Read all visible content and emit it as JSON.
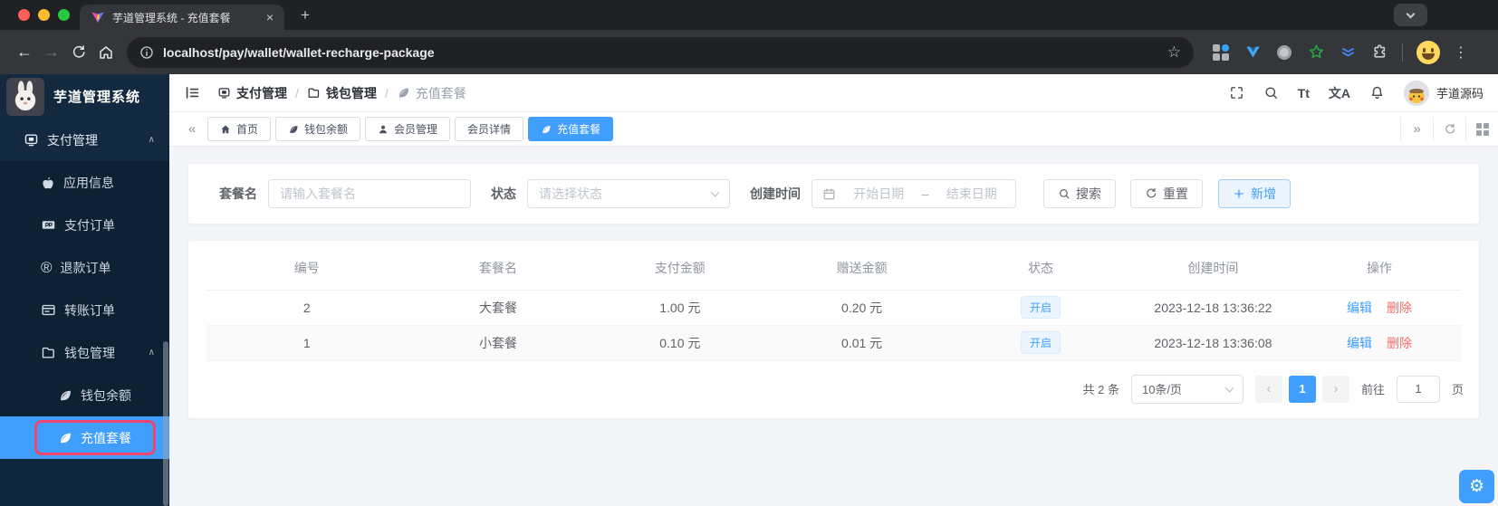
{
  "colors": {
    "accent": "#409eff",
    "danger": "#f56c6c",
    "status_tag_bg": "#ecf5ff",
    "inspect_highlight": "#f0436d",
    "sidebar_bg": "#10263c"
  },
  "browser": {
    "tab_title": "芋道管理系统 - 充值套餐",
    "url": "localhost/pay/wallet/wallet-recharge-package",
    "glyphs": {
      "close": "×",
      "new_tab": "+",
      "back": "←",
      "forward": "→",
      "star": "☆",
      "menu": "⋮"
    }
  },
  "sidebar": {
    "app_title": "芋道管理系统",
    "collapse_glyph": "∧",
    "items": {
      "pay": "支付管理",
      "app_info": "应用信息",
      "pay_order": "支付订单",
      "refund_order": "退款订单",
      "transfer_order": "转账订单",
      "wallet": "钱包管理",
      "wallet_balance": "钱包余额",
      "recharge_package": "充值套餐"
    }
  },
  "breadcrumb": {
    "sep": "/",
    "items": [
      "支付管理",
      "钱包管理",
      "充值套餐"
    ]
  },
  "topbar": {
    "username": "芋道源码",
    "font_size_icon": "Tt",
    "locale_icon": "文A"
  },
  "tags": {
    "left_glyph": "«",
    "right_glyph": "»",
    "items": [
      "首页",
      "钱包余额",
      "会员管理",
      "会员详情",
      "充值套餐"
    ],
    "active_index": 4
  },
  "filter": {
    "name_label": "套餐名",
    "name_placeholder": "请输入套餐名",
    "status_label": "状态",
    "status_placeholder": "请选择状态",
    "date_label": "创建时间",
    "date_start_placeholder": "开始日期",
    "date_separator": "–",
    "date_end_placeholder": "结束日期",
    "search_label": "搜索",
    "reset_label": "重置",
    "add_label": "新增"
  },
  "table": {
    "headers": [
      "编号",
      "套餐名",
      "支付金额",
      "赠送金额",
      "状态",
      "创建时间",
      "操作"
    ],
    "rows": [
      {
        "id": "2",
        "name": "大套餐",
        "pay": "1.00 元",
        "bonus": "0.20 元",
        "status": "开启",
        "created": "2023-12-18 13:36:22",
        "edit": "编辑",
        "delete": "删除"
      },
      {
        "id": "1",
        "name": "小套餐",
        "pay": "0.10 元",
        "bonus": "0.01 元",
        "status": "开启",
        "created": "2023-12-18 13:36:08",
        "edit": "编辑",
        "delete": "删除"
      }
    ]
  },
  "pagination": {
    "total": "共 2 条",
    "size": "10条/页",
    "prev": "‹",
    "page": "1",
    "next": "›",
    "goto_label": "前往",
    "goto_value": "1",
    "unit": "页"
  },
  "settings_glyph": "⚙",
  "icons": {
    "favicon": "vite-logo",
    "tab_search": "chevron-down",
    "omnibox_info": "info-circle",
    "extensions": [
      "grid-extension-icon",
      "vue-devtools-icon",
      "dot-extension-icon",
      "star-extension-icon",
      "layers-extension-icon",
      "extensions-puzzle-icon"
    ],
    "topbar_tools": [
      "fullscreen-icon",
      "search-icon",
      "font-size-icon",
      "locale-icon",
      "bell-icon"
    ],
    "sidebar": [
      "pay-icon",
      "apple-icon",
      "paypal-icon",
      "registered-icon",
      "card-icon",
      "folder-icon",
      "leaf-icon"
    ]
  }
}
